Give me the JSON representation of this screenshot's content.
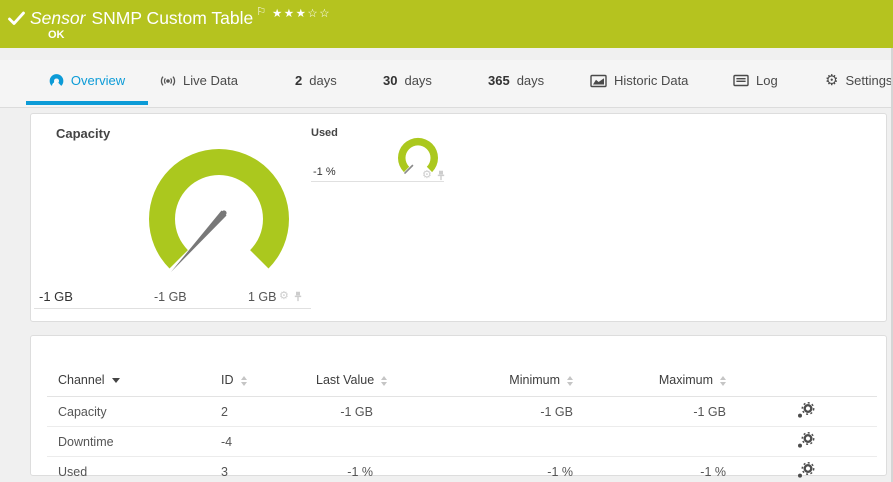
{
  "colors": {
    "green": "#b5c31f",
    "gauge_green": "#abc81e",
    "blue": "#0c9bd7"
  },
  "header": {
    "status_icon": "check-icon",
    "title_prefix": "Sensor",
    "title": "SNMP Custom Table",
    "flag_icon": "flag-icon",
    "rating": {
      "filled": 3,
      "total": 5
    },
    "status": "OK"
  },
  "tabs": [
    {
      "label": "Overview",
      "icon": "gauge-icon",
      "active": true
    },
    {
      "label": "Live Data",
      "icon": "broadcast-icon"
    },
    {
      "num": "2",
      "label": "days"
    },
    {
      "num": "30",
      "label": "days"
    },
    {
      "num": "365",
      "label": "days"
    },
    {
      "label": "Historic Data",
      "icon": "chart-icon"
    },
    {
      "label": "Log",
      "icon": "log-icon"
    },
    {
      "label": "Settings",
      "icon": "gear-icon"
    }
  ],
  "gauges": {
    "capacity": {
      "title": "Capacity",
      "value": "-1 GB",
      "scale_min": "-1 GB",
      "scale_max": "1 GB",
      "needle": "min"
    },
    "used": {
      "title": "Used",
      "value": "-1 %",
      "needle": "min"
    }
  },
  "table": {
    "columns": [
      {
        "label": "Channel",
        "sort": "desc"
      },
      {
        "label": "ID",
        "sort": "both"
      },
      {
        "label": "Last Value",
        "sort": "both"
      },
      {
        "label": "Minimum",
        "sort": "both"
      },
      {
        "label": "Maximum",
        "sort": "both"
      }
    ],
    "rows": [
      {
        "channel": "Capacity",
        "id": "2",
        "last": "-1 GB",
        "min": "-1 GB",
        "max": "-1 GB"
      },
      {
        "channel": "Downtime",
        "id": "-4",
        "last": "",
        "min": "",
        "max": ""
      },
      {
        "channel": "Used",
        "id": "3",
        "last": "-1 %",
        "min": "-1 %",
        "max": "-1 %"
      }
    ]
  }
}
